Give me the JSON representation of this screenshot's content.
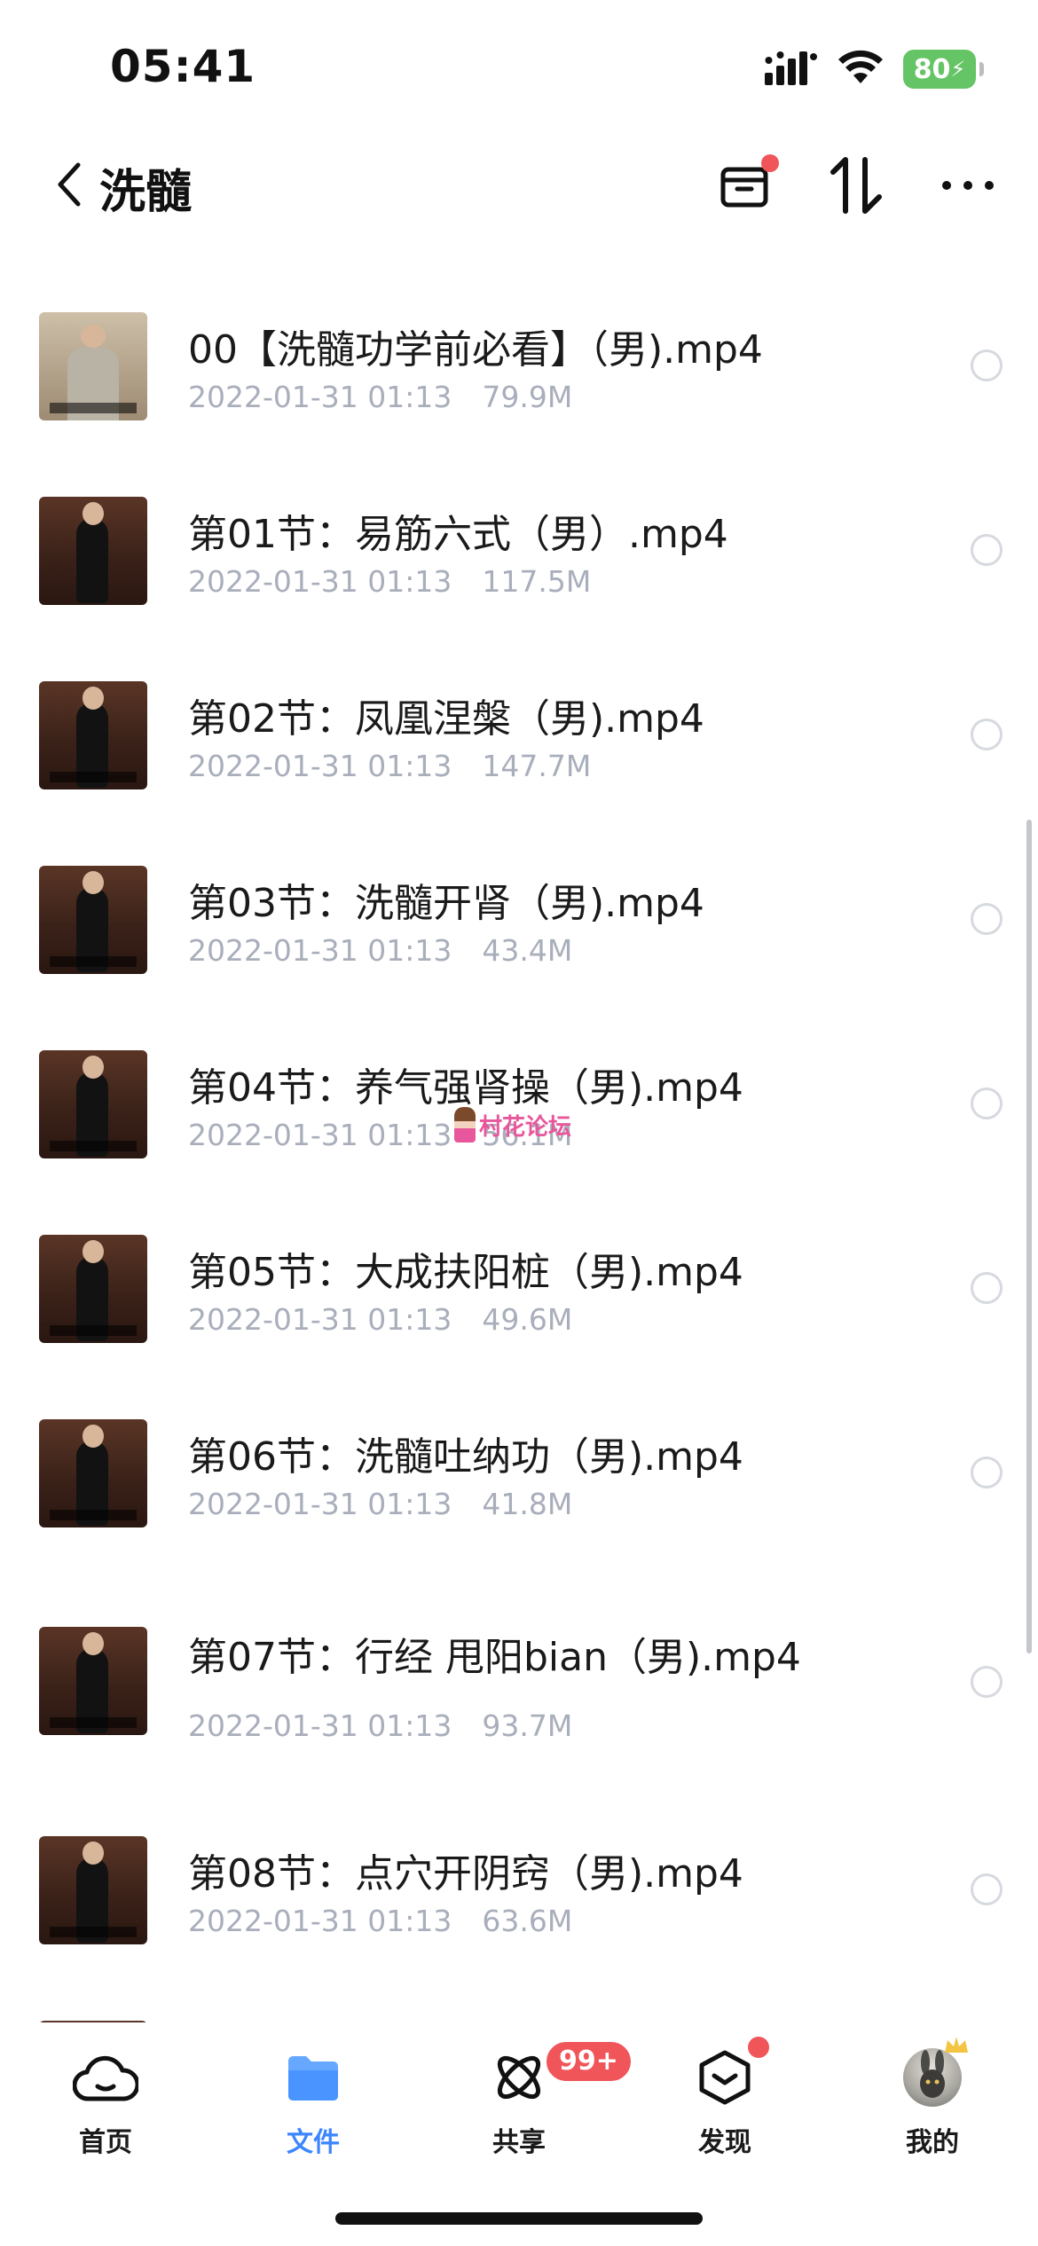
{
  "status_bar": {
    "time": "05:41",
    "battery": "80"
  },
  "header": {
    "title": "洗髓",
    "icons": [
      "back-chevron-icon",
      "box-icon",
      "sort-icon",
      "more-icon"
    ]
  },
  "files": [
    {
      "name": "00【洗髓功学前必看】（男).mp4",
      "date": "2022-01-31 01:13",
      "size": "79.9M"
    },
    {
      "name": "第01节：易筋六式（男）.mp4",
      "date": "2022-01-31 01:13",
      "size": "117.5M"
    },
    {
      "name": "第02节：凤凰涅槃（男).mp4",
      "date": "2022-01-31 01:13",
      "size": "147.7M"
    },
    {
      "name": "第03节：洗髓开肾（男).mp4",
      "date": "2022-01-31 01:13",
      "size": "43.4M"
    },
    {
      "name": "第04节：养气强肾操（男).mp4",
      "date": "2022-01-31 01:13",
      "size": "56.1M"
    },
    {
      "name": "第05节：大成扶阳桩（男).mp4",
      "date": "2022-01-31 01:13",
      "size": "49.6M"
    },
    {
      "name": "第06节：洗髓吐纳功（男).mp4",
      "date": "2022-01-31 01:13",
      "size": "41.8M"
    },
    {
      "name": "第07节：行经 甩阳bian（男).mp4",
      "date": "2022-01-31 01:13",
      "size": "93.7M"
    },
    {
      "name": "第08节：点穴开阴窍（男).mp4",
      "date": "2022-01-31 01:13",
      "size": "63.6M"
    }
  ],
  "watermark": "村花论坛",
  "tabbar": {
    "tabs": [
      {
        "label": "首页",
        "icon": "cloud-home-icon"
      },
      {
        "label": "文件",
        "icon": "folder-icon"
      },
      {
        "label": "共享",
        "icon": "share-orbit-icon"
      },
      {
        "label": "发现",
        "icon": "discover-box-icon"
      },
      {
        "label": "我的",
        "icon": "avatar-icon"
      }
    ],
    "share_badge": "99+",
    "active": "文件"
  },
  "colors": {
    "accent": "#3d86ff",
    "badge": "#f0555a",
    "battery": "#65c466",
    "meta": "#a9aebb"
  }
}
